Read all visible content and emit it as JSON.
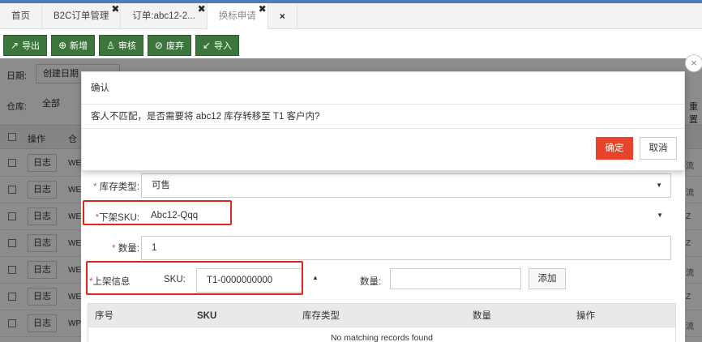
{
  "tabs": [
    {
      "label": "首页",
      "closable": false
    },
    {
      "label": "B2C订单管理",
      "closable": true
    },
    {
      "label": "订单:abc12-2...",
      "closable": true
    },
    {
      "label": "换标申请",
      "closable": true,
      "active": true
    }
  ],
  "extra_tab_close": "×",
  "toolbar": [
    {
      "label": "导出",
      "icon": "export-icon",
      "glyph": "↗"
    },
    {
      "label": "新增",
      "icon": "add-icon",
      "glyph": "⊕"
    },
    {
      "label": "审核",
      "icon": "audit-icon",
      "glyph": "♙"
    },
    {
      "label": "废弃",
      "icon": "discard-icon",
      "glyph": "⊘"
    },
    {
      "label": "导入",
      "icon": "import-icon",
      "glyph": "↙"
    }
  ],
  "filters": {
    "date_label": "日期:",
    "date_value": "创建日期",
    "warehouse_label": "仓库:",
    "warehouse_value": "全部",
    "reset_partial": "重置"
  },
  "grid": {
    "header_ops": "操作",
    "header_wh": "仓",
    "log_label": "日志",
    "rows": [
      "WE",
      "WE",
      "WE",
      "WE",
      "WE",
      "WE",
      "WP"
    ],
    "right_col": [
      "流",
      "流",
      "Z",
      "Z",
      "流",
      "Z",
      "流"
    ]
  },
  "form": {
    "stock_type_label": "库存类型:",
    "stock_type_value": "可售",
    "off_sku_label": "下架SKU:",
    "off_sku_value": "Abc12-Qqq",
    "qty_label": "数量:",
    "qty_value": "1",
    "on_shelf_label": "上架信息",
    "sku_label": "SKU:",
    "sku_value": "T1-0000000000",
    "qty2_label": "数量:",
    "qty2_value": "",
    "add_button": "添加",
    "required_mark": "*",
    "table_headers": [
      "序号",
      "SKU",
      "库存类型",
      "数量",
      "操作"
    ],
    "table_empty": "No matching records found"
  },
  "confirm": {
    "title": "确认",
    "message": "客人不匹配，是否需要将 abc12 库存转移至 T1 客户内?",
    "ok": "确定",
    "cancel": "取消"
  },
  "colors": {
    "toolbar_green": "#3c763d",
    "ok_red": "#e8442b",
    "highlight_red": "#e0251c"
  }
}
